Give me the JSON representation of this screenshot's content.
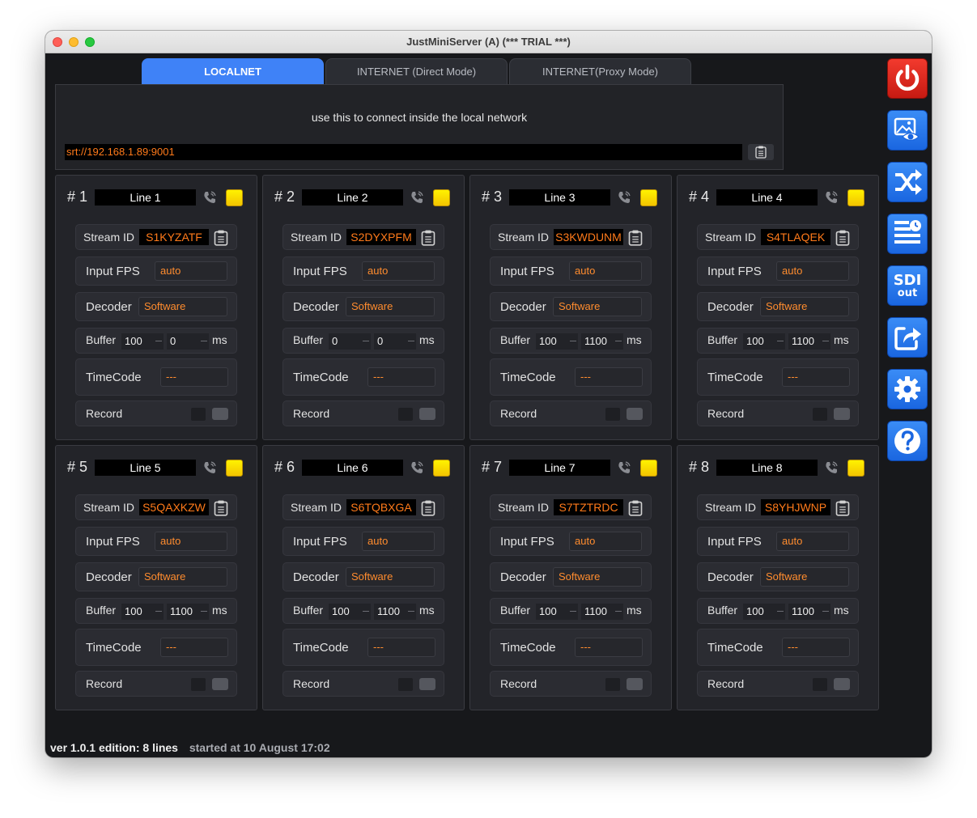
{
  "window": {
    "title": "JustMiniServer (A) (*** TRIAL ***)"
  },
  "tabs": [
    {
      "label": "LOCALNET",
      "active": true
    },
    {
      "label": "INTERNET (Direct Mode)",
      "active": false
    },
    {
      "label": "INTERNET(Proxy Mode)",
      "active": false
    }
  ],
  "connection": {
    "hint": "use this to connect inside the local network",
    "url": "srt://192.168.1.89:9001"
  },
  "labels": {
    "stream_id": "Stream ID",
    "input_fps": "Input FPS",
    "decoder": "Decoder",
    "buffer": "Buffer",
    "ms": "ms",
    "timecode": "TimeCode",
    "record": "Record"
  },
  "lines": [
    {
      "num": "# 1",
      "name": "Line 1",
      "stream_id": "S1KYZATF",
      "input_fps": "auto",
      "decoder": "Software",
      "buffer_a": "100",
      "buffer_b": "0",
      "timecode": "---"
    },
    {
      "num": "# 2",
      "name": "Line 2",
      "stream_id": "S2DYXPFM",
      "input_fps": "auto",
      "decoder": "Software",
      "buffer_a": "0",
      "buffer_b": "0",
      "timecode": "---"
    },
    {
      "num": "# 3",
      "name": "Line 3",
      "stream_id": "S3KWDUNM",
      "input_fps": "auto",
      "decoder": "Software",
      "buffer_a": "100",
      "buffer_b": "1100",
      "timecode": "---"
    },
    {
      "num": "# 4",
      "name": "Line 4",
      "stream_id": "S4TLAQEK",
      "input_fps": "auto",
      "decoder": "Software",
      "buffer_a": "100",
      "buffer_b": "1100",
      "timecode": "---"
    },
    {
      "num": "# 5",
      "name": "Line 5",
      "stream_id": "S5QAXKZW",
      "input_fps": "auto",
      "decoder": "Software",
      "buffer_a": "100",
      "buffer_b": "1100",
      "timecode": "---"
    },
    {
      "num": "# 6",
      "name": "Line 6",
      "stream_id": "S6TQBXGA",
      "input_fps": "auto",
      "decoder": "Software",
      "buffer_a": "100",
      "buffer_b": "1100",
      "timecode": "---"
    },
    {
      "num": "# 7",
      "name": "Line 7",
      "stream_id": "S7TZTRDC",
      "input_fps": "auto",
      "decoder": "Software",
      "buffer_a": "100",
      "buffer_b": "1100",
      "timecode": "---"
    },
    {
      "num": "# 8",
      "name": "Line 8",
      "stream_id": "S8YHJWNP",
      "input_fps": "auto",
      "decoder": "Software",
      "buffer_a": "100",
      "buffer_b": "1100",
      "timecode": "---"
    }
  ],
  "sidebar": {
    "buttons": [
      {
        "icon": "power-icon"
      },
      {
        "icon": "image-preview-icon"
      },
      {
        "icon": "shuffle-icon"
      },
      {
        "icon": "schedule-icon"
      },
      {
        "icon": "sdi-out-icon",
        "label_top": "SDI",
        "label_bottom": "out"
      },
      {
        "icon": "share-icon"
      },
      {
        "icon": "gear-icon"
      },
      {
        "icon": "help-icon"
      }
    ]
  },
  "footer": {
    "version": "ver 1.0.1",
    "edition": "edition: 8 lines",
    "started": "started at 10 August 17:02"
  },
  "colors": {
    "accent": "#3f82f7",
    "value_orange": "#ff7a1a",
    "led_yellow": "#fff200",
    "power_red": "#e0241a"
  }
}
